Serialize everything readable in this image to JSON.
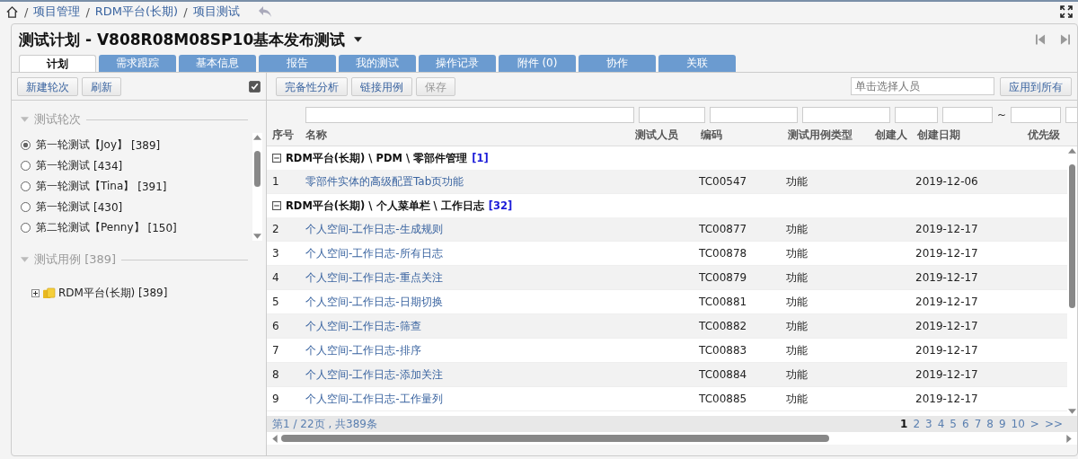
{
  "breadcrumb": {
    "separator": "/",
    "items": [
      "项目管理",
      "RDM平台(长期)",
      "项目测试"
    ]
  },
  "title": "测试计划 - V808R08M08SP10基本发布测试",
  "tabs": [
    {
      "label": "计划",
      "selected": true
    },
    {
      "label": "需求跟踪",
      "selected": false
    },
    {
      "label": "基本信息",
      "selected": false
    },
    {
      "label": "报告",
      "selected": false
    },
    {
      "label": "我的测试",
      "selected": false
    },
    {
      "label": "操作记录",
      "selected": false
    },
    {
      "label": "附件 (0)",
      "selected": false
    },
    {
      "label": "协作",
      "selected": false
    },
    {
      "label": "关联",
      "selected": false
    }
  ],
  "left_panel": {
    "buttons": [
      "新建轮次",
      "刷新"
    ],
    "checked": true,
    "rounds_section": {
      "title": "测试轮次",
      "expanded": true,
      "items": [
        {
          "label": "第一轮测试【Joy】",
          "count": "[389]",
          "selected": true
        },
        {
          "label": "第一轮测试",
          "count": "[434]",
          "selected": false
        },
        {
          "label": "第一轮测试【Tina】",
          "count": "[391]",
          "selected": false
        },
        {
          "label": "第一轮测试",
          "count": "[430]",
          "selected": false
        },
        {
          "label": "第二轮测试【Penny】",
          "count": "[150]",
          "selected": false
        }
      ]
    },
    "cases_section": {
      "title": "测试用例 [389]",
      "expanded": true,
      "tree": [
        {
          "label": "RDM平台(长期) [389]",
          "expanded": false
        }
      ]
    }
  },
  "toolbar": {
    "buttons": [
      {
        "label": "完备性分析",
        "disabled": false
      },
      {
        "label": "链接用例",
        "disabled": false
      },
      {
        "label": "保存",
        "disabled": true
      }
    ],
    "person_field": {
      "placeholder": "单击选择人员"
    },
    "apply_button": "应用到所有"
  },
  "table": {
    "date_separator": "~",
    "columns": [
      "序号",
      "名称",
      "测试人员",
      "编码",
      "测试用例类型",
      "创建人",
      "创建日期",
      "优先级"
    ],
    "groups": [
      {
        "path": "RDM平台(长期) \\ PDM \\ 零部件管理",
        "count": "[1]",
        "expanded": true,
        "rows": [
          {
            "seq": "1",
            "name": "零部件实体的高级配置Tab页功能",
            "code": "TC00547",
            "type": "功能",
            "date": "2019-12-06"
          }
        ]
      },
      {
        "path": "RDM平台(长期) \\ 个人菜单栏 \\ 工作日志",
        "count": "[32]",
        "expanded": true,
        "rows": [
          {
            "seq": "2",
            "name": "个人空间-工作日志-生成规则",
            "code": "TC00877",
            "type": "功能",
            "date": "2019-12-17"
          },
          {
            "seq": "3",
            "name": "个人空间-工作日志-所有日志",
            "code": "TC00878",
            "type": "功能",
            "date": "2019-12-17"
          },
          {
            "seq": "4",
            "name": "个人空间-工作日志-重点关注",
            "code": "TC00879",
            "type": "功能",
            "date": "2019-12-17"
          },
          {
            "seq": "5",
            "name": "个人空间-工作日志-日期切换",
            "code": "TC00881",
            "type": "功能",
            "date": "2019-12-17"
          },
          {
            "seq": "6",
            "name": "个人空间-工作日志-筛查",
            "code": "TC00882",
            "type": "功能",
            "date": "2019-12-17"
          },
          {
            "seq": "7",
            "name": "个人空间-工作日志-排序",
            "code": "TC00883",
            "type": "功能",
            "date": "2019-12-17"
          },
          {
            "seq": "8",
            "name": "个人空间-工作日志-添加关注",
            "code": "TC00884",
            "type": "功能",
            "date": "2019-12-17"
          },
          {
            "seq": "9",
            "name": "个人空间-工作日志-工作量列",
            "code": "TC00885",
            "type": "功能",
            "date": "2019-12-17"
          }
        ]
      }
    ]
  },
  "pagination": {
    "summary": "第1 / 22页 , 共389条",
    "pages": [
      {
        "label": "1",
        "selected": true
      },
      {
        "label": "2",
        "selected": false
      },
      {
        "label": "3",
        "selected": false
      },
      {
        "label": "4",
        "selected": false
      },
      {
        "label": "5",
        "selected": false
      },
      {
        "label": "6",
        "selected": false
      },
      {
        "label": "7",
        "selected": false
      },
      {
        "label": "8",
        "selected": false
      },
      {
        "label": "9",
        "selected": false
      },
      {
        "label": "10",
        "selected": false
      }
    ],
    "next": ">",
    "last": ">>"
  }
}
